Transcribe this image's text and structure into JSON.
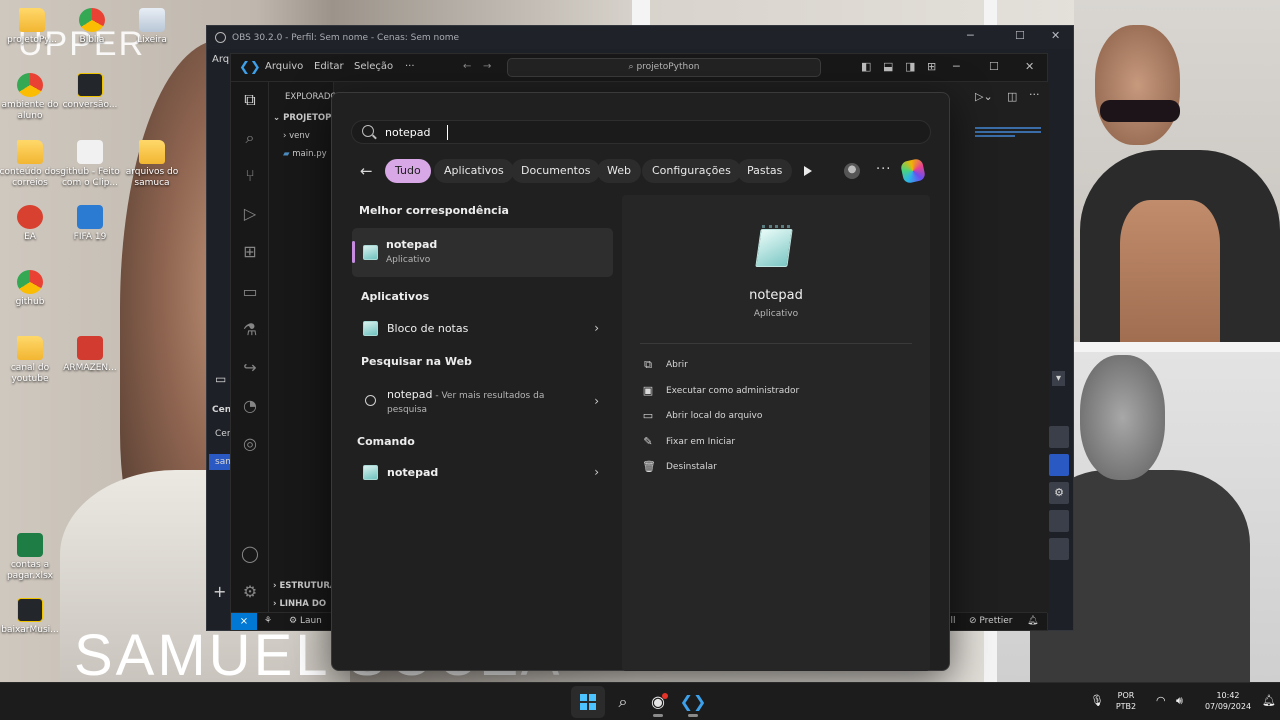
{
  "desktop": {
    "watermark_top": "UPPER",
    "watermark_name": "SAMUEL SOUZA",
    "icons": [
      {
        "label": "projetoPy...",
        "icon": "folder-icon"
      },
      {
        "label": "Bíblia",
        "icon": "chrome-icon"
      },
      {
        "label": "Lixeira",
        "icon": "recycle-bin-icon"
      },
      {
        "label": "ambiente do aluno",
        "icon": "chrome-icon"
      },
      {
        "label": "conversão...",
        "icon": "python-file-icon"
      },
      {
        "label": "conteúdo dos correios",
        "icon": "folder-icon"
      },
      {
        "label": "github - Feito com o Clip...",
        "icon": "document-icon"
      },
      {
        "label": "arquivos do samuca",
        "icon": "folder-icon"
      },
      {
        "label": "EA",
        "icon": "ea-icon"
      },
      {
        "label": "FIFA 19",
        "icon": "game-icon"
      },
      {
        "label": "github",
        "icon": "chrome-icon"
      },
      {
        "label": "canal do youtube",
        "icon": "folder-icon"
      },
      {
        "label": "ARMAZEN...",
        "icon": "pdf-icon"
      },
      {
        "label": "contas a pagar.xlsx",
        "icon": "excel-icon"
      },
      {
        "label": "baixarMusi...",
        "icon": "python-file-icon"
      }
    ]
  },
  "obs": {
    "title": "OBS 30.2.0 - Perfil: Sem nome - Cenas: Sem nome",
    "menu_first": "Arqu",
    "scenes_header": "Cen",
    "scene_item_1": "Cen",
    "scene_item_2": "sam"
  },
  "vscode": {
    "menu": [
      "Arquivo",
      "Editar",
      "Seleção",
      "···"
    ],
    "search_label": "projetoPython",
    "explorer_header": "EXPLORADO",
    "project": "PROJETOPY",
    "tree": [
      "venv",
      "main.py"
    ],
    "outline": "ESTRUTURA",
    "timeline": "LINHA DO",
    "status_left": "Laun",
    "status_right_1": "ell",
    "status_prettier": "Prettier"
  },
  "search": {
    "query": "notepad",
    "filters": [
      "Tudo",
      "Aplicativos",
      "Documentos",
      "Web",
      "Configurações",
      "Pastas"
    ],
    "active_filter": "Tudo",
    "best_match_header": "Melhor correspondência",
    "best_match": {
      "title": "notepad",
      "subtitle": "Aplicativo"
    },
    "apps_header": "Aplicativos",
    "apps": [
      {
        "title": "Bloco de notas"
      }
    ],
    "web_header": "Pesquisar na Web",
    "web": {
      "title": "notepad",
      "suffix": " - Ver mais resultados da",
      "line2": "pesquisa"
    },
    "command_header": "Comando",
    "command": {
      "title": "notepad"
    },
    "detail": {
      "name": "notepad",
      "type": "Aplicativo",
      "actions": [
        {
          "label": "Abrir",
          "icon": "open-external-icon"
        },
        {
          "label": "Executar como administrador",
          "icon": "admin-shield-icon"
        },
        {
          "label": "Abrir local do arquivo",
          "icon": "folder-open-icon"
        },
        {
          "label": "Fixar em Iniciar",
          "icon": "pin-icon"
        },
        {
          "label": "Desinstalar",
          "icon": "trash-icon"
        }
      ]
    }
  },
  "taskbar": {
    "lang_1": "POR",
    "lang_2": "PTB2",
    "time": "10:42",
    "date": "07/09/2024"
  }
}
